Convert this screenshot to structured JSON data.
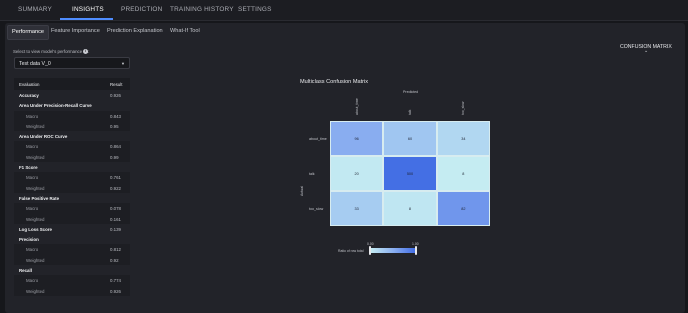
{
  "topnav": {
    "tabs": [
      {
        "label": "SUMMARY"
      },
      {
        "label": "INSIGHTS"
      },
      {
        "label": "PREDICTION"
      },
      {
        "label": "TRAINING HISTORY"
      },
      {
        "label": "SETTINGS"
      }
    ],
    "active": "INSIGHTS"
  },
  "subtabs": [
    {
      "label": "Performance"
    },
    {
      "label": "Feature Importance"
    },
    {
      "label": "Prediction Explanation"
    },
    {
      "label": "What-If Tool"
    }
  ],
  "selector": {
    "label": "Select to view model's performance on:",
    "value": "Test data V_0"
  },
  "evaluation": {
    "header": {
      "evaluation": "Evaluation",
      "result": "Result"
    },
    "rows": [
      {
        "kind": "metric",
        "label": "Accuracy",
        "value": "0.926"
      },
      {
        "kind": "metric",
        "label": "Area Under Precision-Recall Curve",
        "value": ""
      },
      {
        "kind": "sub",
        "label": "Macro",
        "value": "0.843"
      },
      {
        "kind": "sub",
        "label": "Weighted",
        "value": "0.95"
      },
      {
        "kind": "metric",
        "label": "Area Under ROC Curve",
        "value": ""
      },
      {
        "kind": "sub",
        "label": "Macro",
        "value": "0.864"
      },
      {
        "kind": "sub",
        "label": "Weighted",
        "value": "0.99"
      },
      {
        "kind": "metric",
        "label": "F1 Score",
        "value": ""
      },
      {
        "kind": "sub",
        "label": "Macro",
        "value": "0.761"
      },
      {
        "kind": "sub",
        "label": "Weighted",
        "value": "0.922"
      },
      {
        "kind": "metric",
        "label": "False Positive Rate",
        "value": ""
      },
      {
        "kind": "sub",
        "label": "Macro",
        "value": "0.078"
      },
      {
        "kind": "sub",
        "label": "Weighted",
        "value": "0.161"
      },
      {
        "kind": "metric",
        "label": "Log Loss Score",
        "value": "0.139"
      },
      {
        "kind": "metric",
        "label": "Precision",
        "value": ""
      },
      {
        "kind": "sub",
        "label": "Macro",
        "value": "0.812"
      },
      {
        "kind": "sub",
        "label": "Weighted",
        "value": "0.92"
      },
      {
        "kind": "metric",
        "label": "Recall",
        "value": ""
      },
      {
        "kind": "sub",
        "label": "Macro",
        "value": "0.774"
      },
      {
        "kind": "sub",
        "label": "Weighted",
        "value": "0.926"
      }
    ]
  },
  "confusion_matrix_button": {
    "label": "CONFUSION MATRIX",
    "icon": "chevron-down-icon"
  },
  "chart_data": {
    "type": "heatmap",
    "title": "Multiclass Confusion Matrix",
    "xlabel": "Predicted",
    "ylabel": "Actual",
    "columns": [
      "about_time",
      "talk",
      "too_slow"
    ],
    "rows": [
      "about_time",
      "talk",
      "too_slow"
    ],
    "values": [
      [
        96,
        60,
        34
      ],
      [
        20,
        500,
        8
      ],
      [
        33,
        8,
        82
      ]
    ],
    "colorbar": {
      "label": "Ratio of row total",
      "ticks": [
        "0.00",
        "1.00"
      ],
      "colors": [
        "#c7eef2",
        "#8aaef0",
        "#3c67e3"
      ]
    }
  },
  "colors": {
    "accent": "#4f8dff",
    "background": "#16171b",
    "panel": "#222329"
  }
}
